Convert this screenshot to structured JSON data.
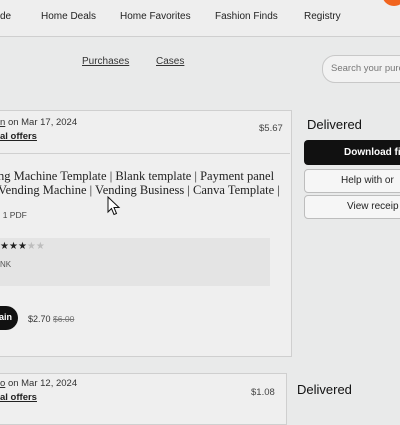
{
  "nav": {
    "items": [
      "de",
      "Home Deals",
      "Home Favorites",
      "Fashion Finds",
      "Registry"
    ]
  },
  "subnav": {
    "purchases": "Purchases",
    "cases": "Cases",
    "search_placeholder": "Search your purc"
  },
  "order1": {
    "seller_suffix": "n",
    "date_text": "on Mar 17, 2024",
    "offers": "al offers",
    "total": "$5.67",
    "title_line1": "ng Machine Template | Blank template | Payment panel",
    "title_line2": "Vending Machine | Vending Business | Canva Template |",
    "file_info": ": 1 PDF",
    "review_stars_filled": 3,
    "review_stars_total": 5,
    "review_text": "NK",
    "buy_button": "ain",
    "price": "$2.70",
    "original_price": "$6.00",
    "status": "Delivered",
    "download_button": "Download fi",
    "help_button": "Help with or",
    "receipt_button": "View receip"
  },
  "order2": {
    "seller_suffix": "o",
    "date_text": "on Mar 12, 2024",
    "offers": "al offers",
    "total": "$1.08",
    "status": "Delivered"
  },
  "colors": {
    "accent_orange": "#f1641e",
    "primary_button": "#111111"
  }
}
